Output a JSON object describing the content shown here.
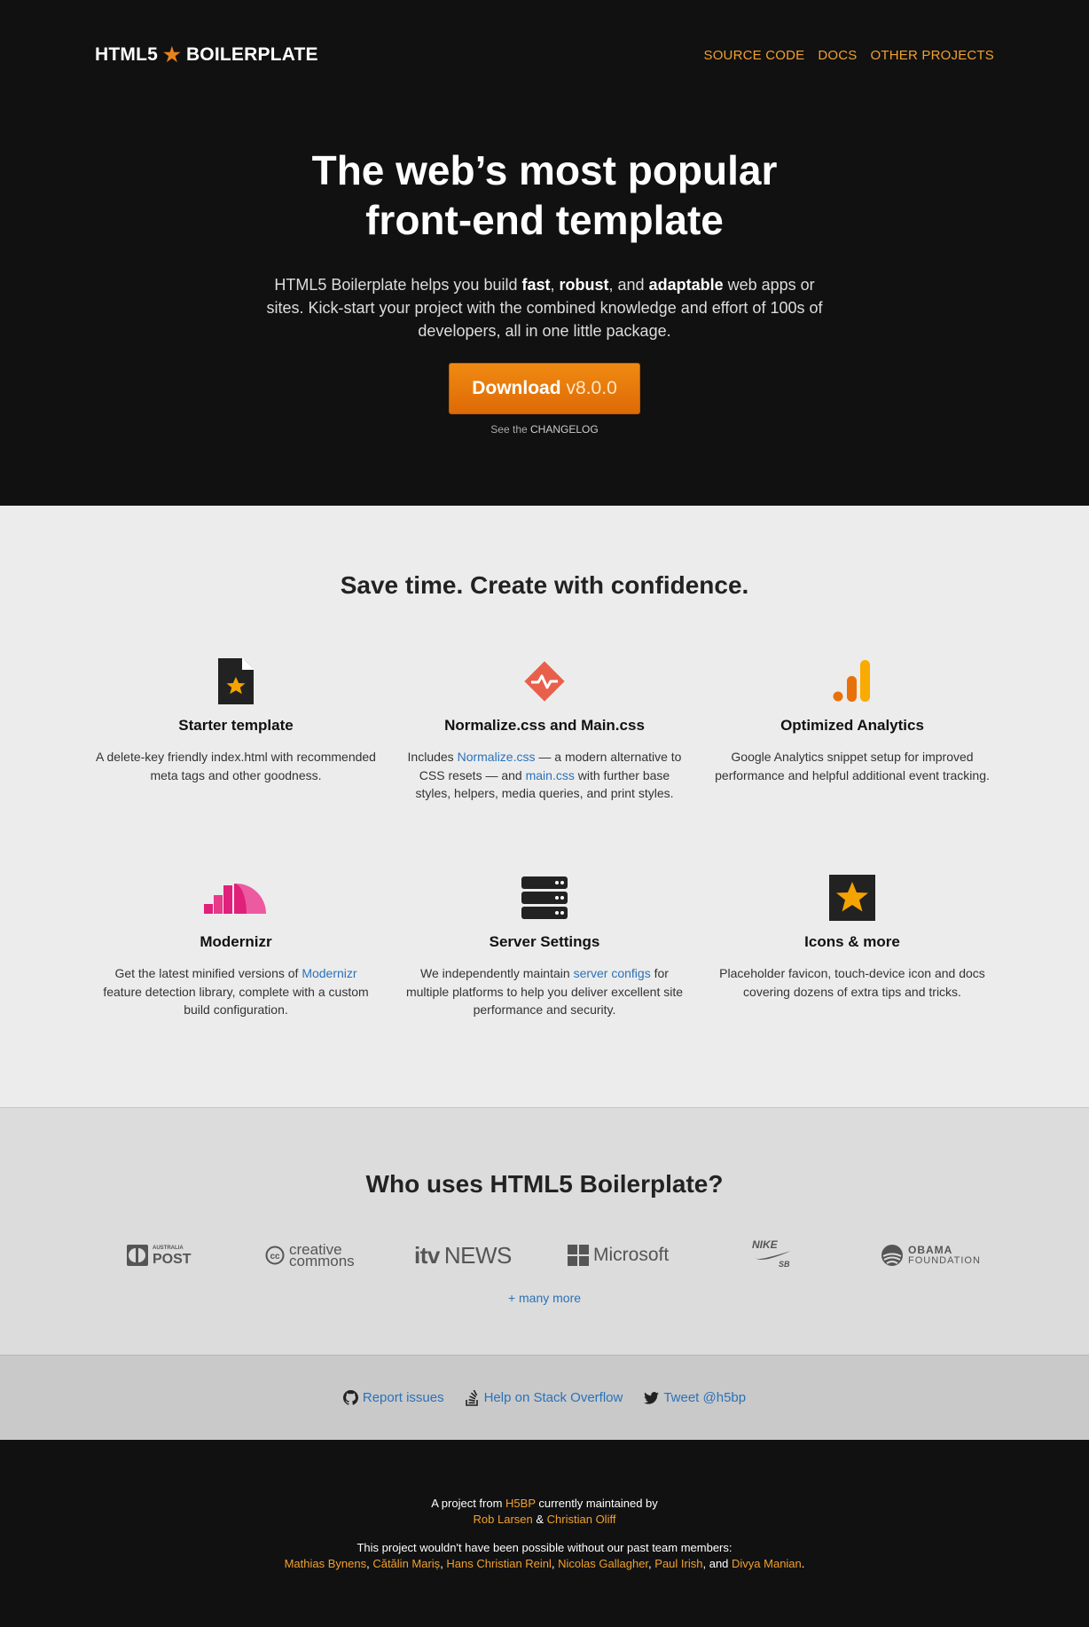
{
  "header": {
    "logo_left": "HTML5",
    "logo_star": "★",
    "logo_right": "BOILERPLATE",
    "nav": [
      "SOURCE CODE",
      "DOCS",
      "OTHER PROJECTS"
    ]
  },
  "hero": {
    "title_line1": "The web’s most popular",
    "title_line2": "front-end template",
    "lead_1": "HTML5 Boilerplate helps you build ",
    "lead_fast": "fast",
    "lead_2": ", ",
    "lead_robust": "robust",
    "lead_3": ", and ",
    "lead_adaptable": "adaptable",
    "lead_4": " web apps or sites. Kick-start your project with the combined knowledge and effort of 100s of developers, all in one little package.",
    "download_label": "Download",
    "download_version": "v8.0.0",
    "changelog_prefix": "See the ",
    "changelog_link": "CHANGELOG"
  },
  "features": {
    "title": "Save time. Create with confidence.",
    "items": [
      {
        "icon": "starter-template-icon",
        "title": "Starter template",
        "text": "A delete-key friendly index.html with recommended meta tags and other goodness."
      },
      {
        "icon": "normalize-icon",
        "title": "Normalize.css and Main.css",
        "t1": "Includes ",
        "l1": "Normalize.css",
        "t2": " — a modern alternative to CSS resets — and ",
        "l2": "main.css",
        "t3": " with further base styles, helpers, media queries, and print styles."
      },
      {
        "icon": "analytics-icon",
        "title": "Optimized Analytics",
        "text": "Google Analytics snippet setup for improved performance and helpful additional event tracking."
      },
      {
        "icon": "modernizr-icon",
        "title": "Modernizr",
        "t1": "Get the latest minified versions of ",
        "l1": "Modernizr",
        "t2": " feature detection library, complete with a custom build configuration."
      },
      {
        "icon": "server-icon",
        "title": "Server Settings",
        "t1": "We independently maintain ",
        "l1": "server configs",
        "t2": " for multiple platforms to help you deliver excellent site performance and security."
      },
      {
        "icon": "star-box-icon",
        "title": "Icons & more",
        "text": "Placeholder favicon, touch-device icon and docs covering dozens of extra tips and tricks."
      }
    ]
  },
  "users": {
    "title": "Who uses HTML5 Boilerplate?",
    "logos": {
      "post_small": "AUSTRALIA",
      "post": "POST",
      "cc_line1": "creative",
      "cc_line2": "commons",
      "itv": "itv",
      "itv_news": "NEWS",
      "microsoft": "Microsoft",
      "nike": "NIKE",
      "nike_sb": "SB",
      "obama_line1": "OBAMA",
      "obama_line2": "FOUNDATION"
    },
    "more": "+ many more"
  },
  "links": [
    {
      "icon": "github-icon",
      "label": "Report issues"
    },
    {
      "icon": "stack-overflow-icon",
      "label": "Help on Stack Overflow"
    },
    {
      "icon": "twitter-icon",
      "label": "Tweet @h5bp"
    }
  ],
  "footer": {
    "p1_a": "A project from ",
    "h5bp": "H5BP",
    "p1_b": " currently maintained by",
    "rob": "Rob Larsen",
    "amp": " & ",
    "christian": "Christian Oliff",
    "p2": "This project wouldn't have been possible without our past team members:",
    "past": [
      "Mathias Bynens",
      "Cătălin Mariș",
      "Hans Christian Reinl",
      "Nicolas Gallagher",
      "Paul Irish"
    ],
    "and": ", and ",
    "last": "Divya Manian",
    "comma": ", ",
    "period": "."
  },
  "colors": {
    "accent": "#f0a030",
    "link": "#2a72b8",
    "button": "#ec7d0c"
  }
}
